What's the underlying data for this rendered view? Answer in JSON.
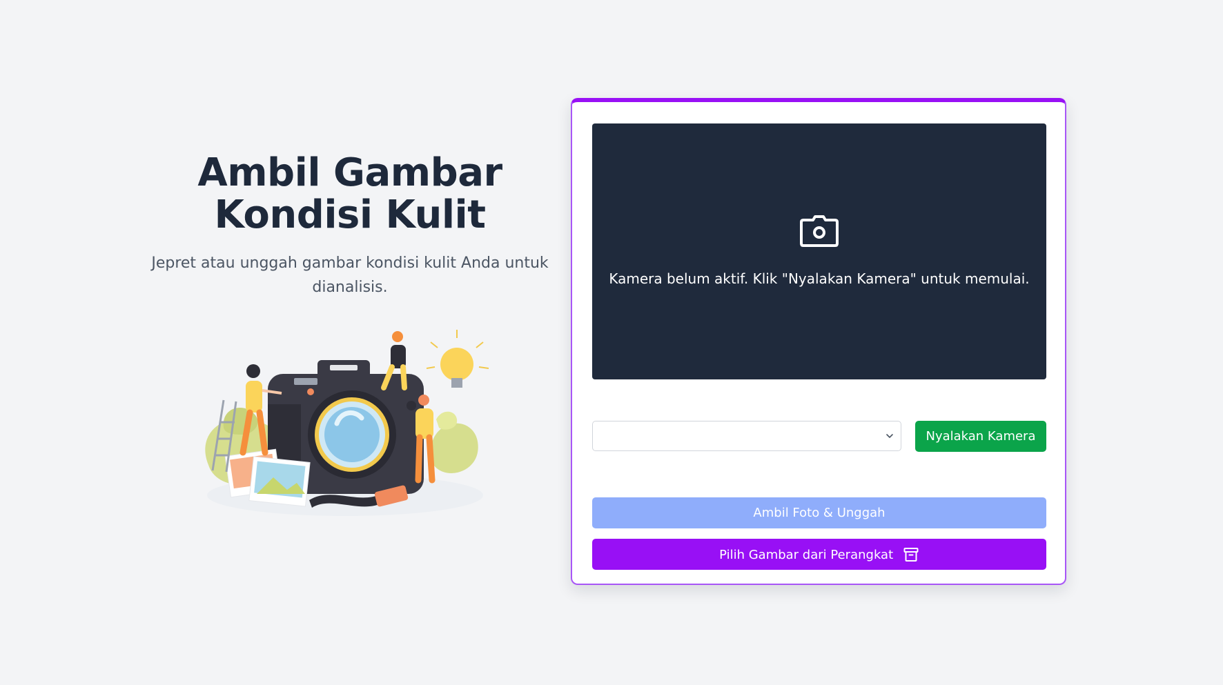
{
  "hero": {
    "title_line1": "Ambil Gambar",
    "title_line2": "Kondisi Kulit",
    "subtitle": "Jepret atau unggah gambar kondisi kulit Anda untuk dianalisis.",
    "illustration_icon": "camera-people-illustration"
  },
  "card": {
    "accent_color": "#9810f5",
    "preview": {
      "icon": "camera-icon",
      "message": "Kamera belum aktif. Klik \"Nyalakan Kamera\" untuk memulai."
    },
    "camera_select": {
      "selected": ""
    },
    "buttons": {
      "start_camera": "Nyalakan Kamera",
      "capture_upload": "Ambil Foto & Unggah",
      "pick_from_device": "Pilih Gambar dari Perangkat",
      "pick_icon": "archive-icon"
    },
    "colors": {
      "start_camera": "#0ba44a",
      "capture_upload": "#8fadfb",
      "pick_from_device": "#9810f5",
      "preview_bg": "#1f2a3c"
    }
  }
}
